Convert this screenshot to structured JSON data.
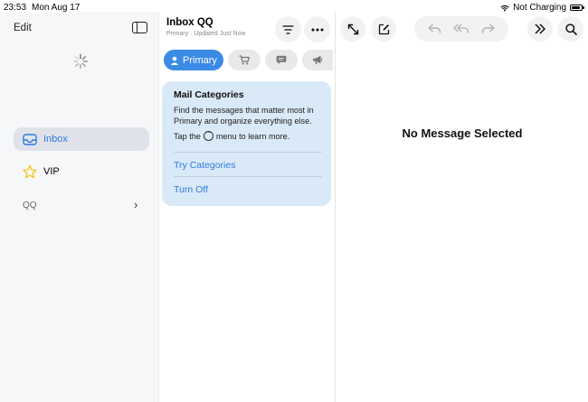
{
  "status_bar": {
    "time": "23:53",
    "date": "Mon Aug 17",
    "charging": "Not Charging",
    "battery_level": 0.85
  },
  "sidebar": {
    "edit_label": "Edit",
    "items": [
      {
        "label": "Inbox",
        "icon": "inbox-tray-icon",
        "active": true
      },
      {
        "label": "VIP",
        "icon": "star-icon",
        "active": false
      }
    ],
    "account_label": "QQ"
  },
  "mailbox": {
    "title": "Inbox QQ",
    "subtitle": "Primary · Updated Just Now",
    "categories": [
      {
        "label": "Primary",
        "icon": "person-icon",
        "selected": true
      },
      {
        "label": "",
        "icon": "cart-icon",
        "selected": false
      },
      {
        "label": "",
        "icon": "message-bubble-icon",
        "selected": false
      },
      {
        "label": "",
        "icon": "megaphone-icon",
        "selected": false
      }
    ]
  },
  "categories_card": {
    "title": "Mail Categories",
    "body": "Find the messages that matter most in Primary and organize everything else.",
    "hint_before": "Tap the",
    "hint_after": "menu to learn more.",
    "try_label": "Try Categories",
    "off_label": "Turn Off"
  },
  "detail": {
    "empty_text": "No Message Selected"
  },
  "colors": {
    "accent": "#3b8ae6",
    "link": "#2f7bde",
    "card_bg": "#d9e9f8",
    "sidebar_bg": "#f6f7f9",
    "vip_star": "#f5c518"
  }
}
